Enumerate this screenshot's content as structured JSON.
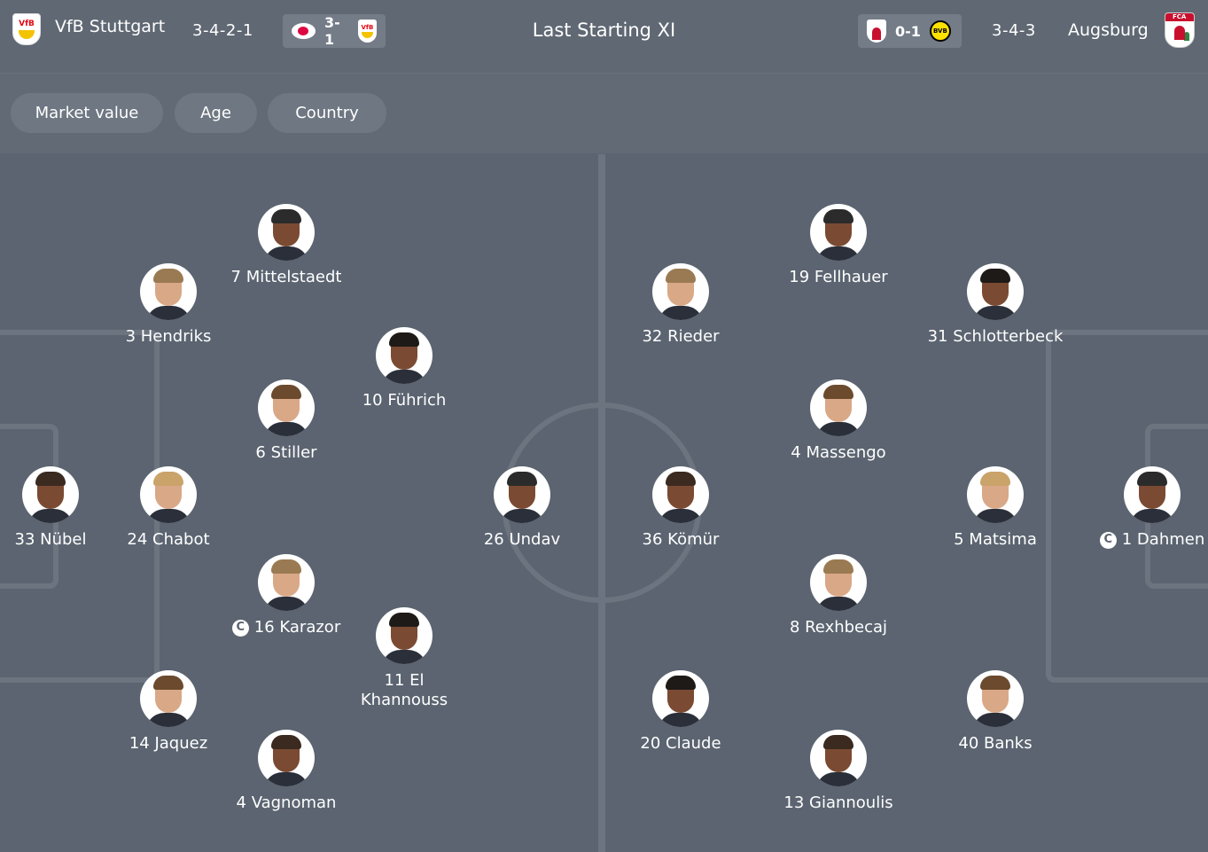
{
  "header": {
    "home_team": "VfB Stuttgart",
    "home_formation": "3-4-2-1",
    "home_last_score": "3-1",
    "title": "Last Starting XI",
    "away_last_score": "0-1",
    "away_formation": "3-4-3",
    "away_team": "Augsburg"
  },
  "filters": [
    "Market value",
    "Age",
    "Country"
  ],
  "home_players": [
    {
      "label": "7 Mittelstaedt",
      "captain": false
    },
    {
      "label": "3 Hendriks",
      "captain": false
    },
    {
      "label": "10 Führich",
      "captain": false
    },
    {
      "label": "6 Stiller",
      "captain": false
    },
    {
      "label": "33 Nübel",
      "captain": false
    },
    {
      "label": "24 Chabot",
      "captain": false
    },
    {
      "label": "26 Undav",
      "captain": false
    },
    {
      "label": "16 Karazor",
      "captain": true
    },
    {
      "label": "11 El Khannouss",
      "captain": false
    },
    {
      "label": "14 Jaquez",
      "captain": false
    },
    {
      "label": "4 Vagnoman",
      "captain": false
    }
  ],
  "away_players": [
    {
      "label": "19 Fellhauer",
      "captain": false
    },
    {
      "label": "32 Rieder",
      "captain": false
    },
    {
      "label": "31 Schlotterbeck",
      "captain": false
    },
    {
      "label": "4 Massengo",
      "captain": false
    },
    {
      "label": "36 Kömür",
      "captain": false
    },
    {
      "label": "5 Matsima",
      "captain": false
    },
    {
      "label": "1 Dahmen",
      "captain": true
    },
    {
      "label": "8 Rexhbecaj",
      "captain": false
    },
    {
      "label": "20 Claude",
      "captain": false
    },
    {
      "label": "40 Banks",
      "captain": false
    },
    {
      "label": "13 Giannoulis",
      "captain": false
    }
  ],
  "captain_symbol": "C",
  "crest_text": {
    "vfb": "VfB",
    "fca": "FCA",
    "bvb": "BVB"
  },
  "colors": {
    "background": "#5b6470",
    "pitch_lines": "#6c747f",
    "chip": "#737c87"
  }
}
